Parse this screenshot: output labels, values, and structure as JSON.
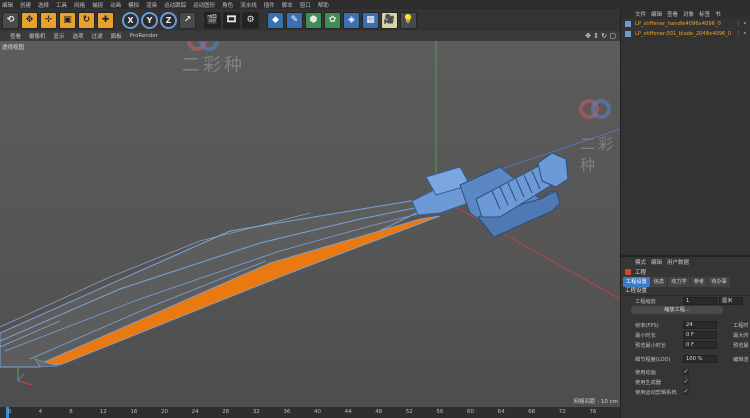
{
  "menubar": [
    "编辑",
    "创建",
    "选择",
    "工具",
    "网格",
    "捕捉",
    "动画",
    "模拟",
    "渲染",
    "运动跟踪",
    "运动图形",
    "角色",
    "流水线",
    "插件",
    "脚本",
    "窗口",
    "帮助"
  ],
  "toolbar": {
    "axis_x": "X",
    "axis_y": "Y",
    "axis_z": "Z"
  },
  "viewport_menu": [
    "查看",
    "摄像机",
    "显示",
    "选项",
    "过滤",
    "面板",
    "ProRender"
  ],
  "viewport": {
    "label": "透视视图",
    "grid_info": "网格间距 : 10 cm"
  },
  "watermark": "二彩种",
  "object_manager": {
    "menu": [
      "文件",
      "编辑",
      "查看",
      "对象",
      "标签",
      "书"
    ],
    "objects": [
      {
        "name": "LP_stiffener_handle4096x4096_0"
      },
      {
        "name": "LP_stiffener.001_blade_2048x4096_0"
      }
    ]
  },
  "attributes": {
    "menu": [
      "模式",
      "编辑",
      "用户数据"
    ],
    "title": "工程",
    "tabs": [
      "工程设置",
      "信息",
      "动力学",
      "参考",
      "待办事"
    ],
    "section": "工程设置",
    "scale_label": "工程缩放",
    "scale_value": "1",
    "scale_unit": "厘米",
    "scale_button": "缩放工程...",
    "fps_label": "帧率(FPS)",
    "fps_value": "24",
    "right_fps_label": "工程时",
    "min_time_label": "最小时长",
    "min_time_value": "0 F",
    "right_max_label": "最大时",
    "preview_min_label": "预览最小时长",
    "preview_min_value": "0 F",
    "right_preview_label": "预览最",
    "lod_label": "细节程度(LOD)",
    "lod_value": "100 %",
    "right_lod_label": "编辑渲",
    "use_anim_label": "使用动画",
    "use_gen_label": "使用生成器",
    "use_motion_label": "使用运动剪辑系统"
  },
  "timeline": {
    "ticks": [
      "0",
      "4",
      "8",
      "12",
      "16",
      "20",
      "24",
      "28",
      "32",
      "36",
      "40",
      "44",
      "48",
      "52",
      "56",
      "60",
      "64",
      "68",
      "72",
      "76"
    ]
  },
  "colors": {
    "accent_orange": "#e8a12a",
    "mesh_blue": "#6b9ad6",
    "face_orange": "#ea7a10",
    "tab_blue": "#3b7dc4"
  }
}
